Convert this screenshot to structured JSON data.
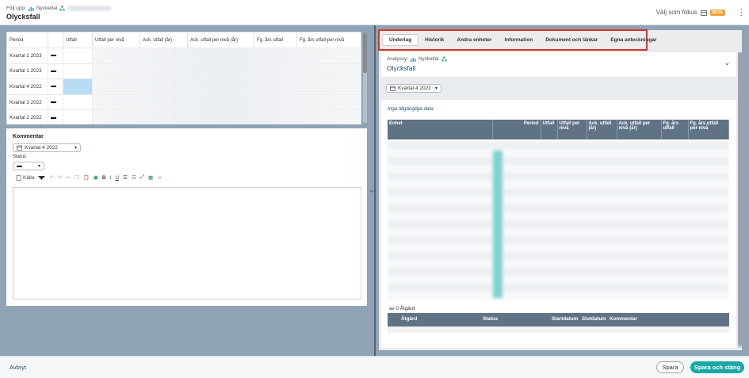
{
  "header": {
    "follow_label": "Följ upp:",
    "follow_kpi": "Nyckeltal",
    "title": "Olycksfall",
    "focus_label": "Välj som fokus",
    "beta": "BETA"
  },
  "left_table": {
    "columns": [
      "Period",
      "",
      "Utfall",
      "Utfall per nivå",
      "Ack. utfall (år)",
      "Ack. utfall per nivå (år)",
      "Fg. års utfall",
      "Fg. års utfall per nivå"
    ],
    "rows": [
      {
        "period": "Kvartal 2 2023"
      },
      {
        "period": "Kvartal 1 2023"
      },
      {
        "period": "Kvartal 4 2022"
      },
      {
        "period": "Kvartal 3 2022"
      },
      {
        "period": "Kvartal 2 2022"
      }
    ]
  },
  "comment": {
    "heading": "Kommentar",
    "period_select": "Kvartal 4 2022",
    "status_label": "Status",
    "toolbar_source": "Källa",
    "toolbar_buttons": [
      "B",
      "I",
      "U"
    ]
  },
  "right": {
    "tabs": [
      "Underlag",
      "Historik",
      "Andra enheter",
      "Information",
      "Dokument och länkar",
      "Egna anteckningar"
    ],
    "analysis_label": "Analysvy:",
    "analysis_kpi": "Nyckeltal",
    "analysis_title": "Olycksfall",
    "period_select": "Kvartal 4 2022",
    "no_data": "Inga tillgängliga data",
    "data_columns": [
      "Enhet",
      "Period",
      "Utfall",
      "Utfall per nivå",
      "Ack. utfall (år)",
      "Ack. utfall per nivå (år)",
      "Fg. års utfall",
      "Fg. års utfall per nivå"
    ],
    "actions_count": "av 0 Åtgärd",
    "action_columns": [
      "Åtgärd",
      "Status",
      "Startdatum",
      "Slutdatum",
      "Kommentar"
    ]
  },
  "footer": {
    "cancel": "Avbryt",
    "save": "Spara",
    "save_close": "Spara och stäng"
  },
  "colors": {
    "accent": "#19a8a4",
    "table_header": "#5f7385",
    "highlight": "#d9342b"
  }
}
